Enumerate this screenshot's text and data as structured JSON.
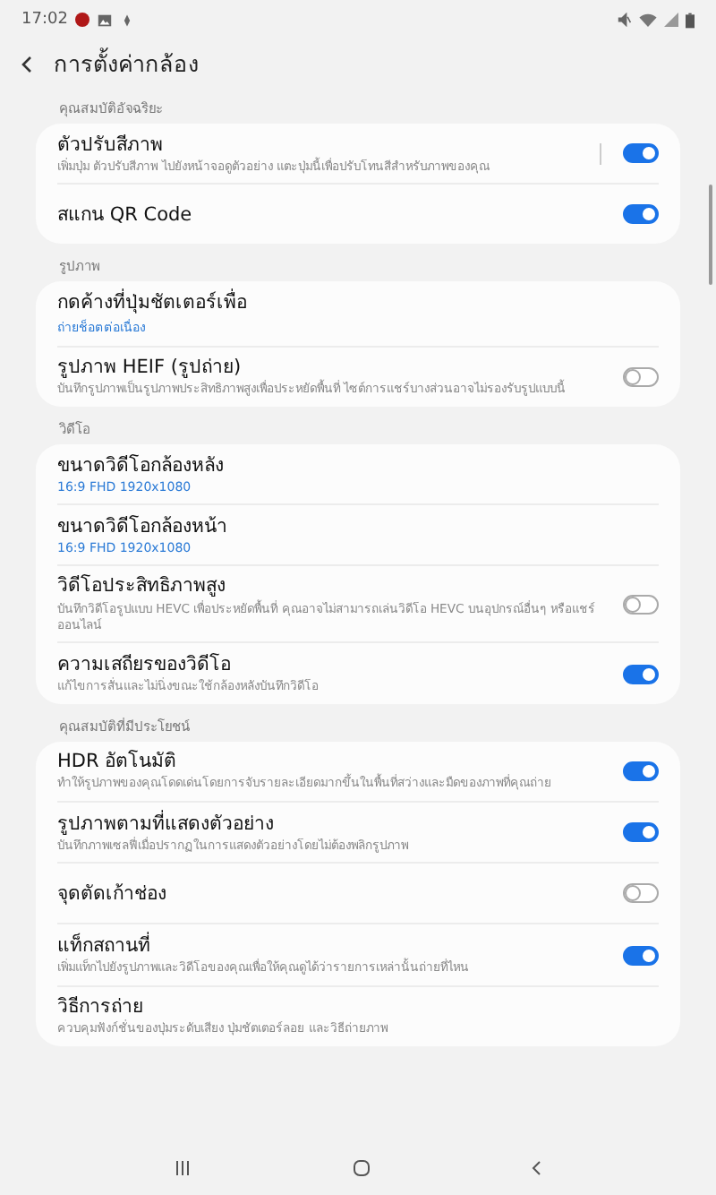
{
  "status_bar": {
    "time": "17:02"
  },
  "header": {
    "title": "การตั้งค่ากล้อง"
  },
  "sections": [
    {
      "label": "คุณสมบัติอัจฉริยะ",
      "items": [
        {
          "kind": "split-toggle",
          "title": "ตัวปรับสีภาพ",
          "description": "เพิ่มปุ่ม ตัวปรับสีภาพ ไปยังหน้าจอดูตัวอย่าง แตะปุ่มนี้เพื่อปรับโทนสีสำหรับภาพของคุณ",
          "on": true
        },
        {
          "kind": "toggle",
          "title": "สแกน QR Code",
          "on": true
        }
      ]
    },
    {
      "label": "รูปภาพ",
      "items": [
        {
          "kind": "value",
          "title": "กดค้างที่ปุ่มชัตเตอร์เพื่อ",
          "value": "ถ่ายช็อตต่อเนื่อง"
        },
        {
          "kind": "toggle",
          "title": "รูปภาพ HEIF (รูปถ่าย)",
          "description": "บันทึกรูปภาพเป็นรูปภาพประสิทธิภาพสูงเพื่อประหยัดพื้นที่ ไซต์การแชร์บางส่วนอาจไม่รองรับรูปแบบนี้",
          "on": false
        }
      ]
    },
    {
      "label": "วิดีโอ",
      "items": [
        {
          "kind": "value",
          "title": "ขนาดวิดีโอกล้องหลัง",
          "value": "16:9 FHD 1920x1080"
        },
        {
          "kind": "value",
          "title": "ขนาดวิดีโอกล้องหน้า",
          "value": "16:9 FHD 1920x1080"
        },
        {
          "kind": "toggle",
          "title": "วิดีโอประสิทธิภาพสูง",
          "description": "บันทึกวิดีโอรูปแบบ HEVC เพื่อประหยัดพื้นที่ คุณอาจไม่สามารถเล่นวิดีโอ HEVC บนอุปกรณ์อื่นๆ หรือแชร์ออนไลน์",
          "on": false
        },
        {
          "kind": "toggle",
          "title": "ความเสถียรของวิดีโอ",
          "description": "แก้ไขการสั่นและไม่นิ่งขณะใช้กล้องหลังบันทึกวิดีโอ",
          "on": true
        }
      ]
    },
    {
      "label": "คุณสมบัติที่มีประโยชน์",
      "items": [
        {
          "kind": "toggle",
          "title": "HDR อัตโนมัติ",
          "description": "ทำให้รูปภาพของคุณโดดเด่นโดยการจับรายละเอียดมากขึ้นในพื้นที่สว่างและมืดของภาพที่คุณถ่าย",
          "on": true
        },
        {
          "kind": "toggle",
          "title": "รูปภาพตามที่แสดงตัวอย่าง",
          "description": "บันทึกภาพเซลฟี่เมื่อปรากฏในการแสดงตัวอย่างโดยไม่ต้องพลิกรูปภาพ",
          "on": true
        },
        {
          "kind": "toggle",
          "title": "จุดตัดเก้าช่อง",
          "on": false
        },
        {
          "kind": "toggle",
          "title": "แท็กสถานที่",
          "description": "เพิ่มแท็กไปยังรูปภาพและวิดีโอของคุณเพื่อให้คุณดูได้ว่ารายการเหล่านั้นถ่ายที่ไหน",
          "on": true
        },
        {
          "kind": "plain",
          "title": "วิธีการถ่าย",
          "description": "ควบคุมฟังก์ชั่นของปุ่มระดับเสียง ปุ่มชัตเตอร์ลอย และวิธีถ่ายภาพ"
        }
      ]
    }
  ]
}
